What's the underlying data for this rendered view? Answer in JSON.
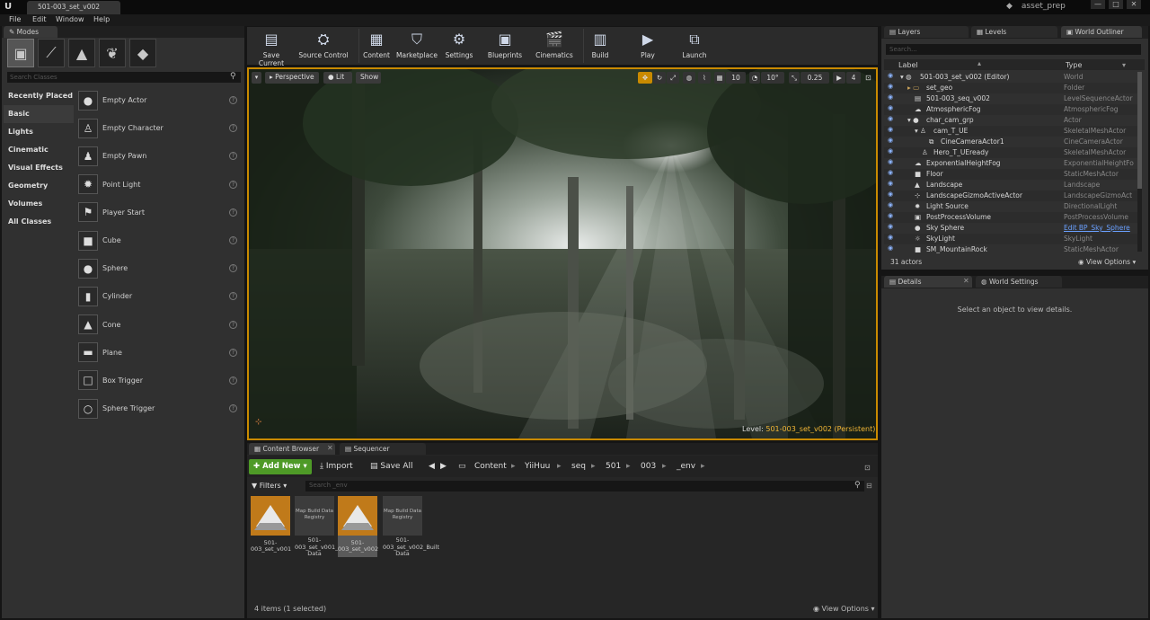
{
  "window": {
    "doc_tab": "501-003_set_v002",
    "project_name": "asset_prep",
    "controls": [
      "—",
      "□",
      "✕"
    ]
  },
  "menu": [
    "File",
    "Edit",
    "Window",
    "Help"
  ],
  "modes": {
    "tab_label": "Modes",
    "search_placeholder": "Search Classes",
    "categories": [
      "Recently Placed",
      "Basic",
      "Lights",
      "Cinematic",
      "Visual Effects",
      "Geometry",
      "Volumes",
      "All Classes"
    ],
    "active_category": "Basic",
    "classes": [
      "Empty Actor",
      "Empty Character",
      "Empty Pawn",
      "Point Light",
      "Player Start",
      "Cube",
      "Sphere",
      "Cylinder",
      "Cone",
      "Plane",
      "Box Trigger",
      "Sphere Trigger"
    ],
    "help_glyph": "?"
  },
  "toolbar": {
    "buttons": [
      "Save Current",
      "Source Control",
      "Content",
      "Marketplace",
      "Settings",
      "Blueprints",
      "Cinematics",
      "Build",
      "Play",
      "Launch"
    ]
  },
  "viewport": {
    "mode_buttons": [
      "Perspective",
      "Lit",
      "Show"
    ],
    "grid_snap": "10",
    "rot_snap": "10°",
    "scale_snap": "0.25",
    "camera_speed": "4",
    "level_label": "Level:",
    "level_value": "501-003_set_v002 (Persistent)"
  },
  "content_browser": {
    "tabs": [
      "Content Browser",
      "Sequencer"
    ],
    "add_new": "Add New",
    "import": "Import",
    "save_all": "Save All",
    "breadcrumb": [
      "Content",
      "YiiHuu",
      "seq",
      "501",
      "003",
      "_env"
    ],
    "filters": "Filters",
    "search_placeholder": "Search _env",
    "assets": [
      {
        "label": "501-003_set_v001",
        "thumb": "level",
        "selected": false
      },
      {
        "label": "501-003_set_v001_Built Data",
        "thumb": "Map Build Data Registry",
        "selected": false
      },
      {
        "label": "501-003_set_v002",
        "thumb": "level",
        "selected": true
      },
      {
        "label": "501-003_set_v002_Built Data",
        "thumb": "Map Build Data Registry",
        "selected": false
      }
    ],
    "status": "4 items (1 selected)",
    "view_options": "View Options"
  },
  "outliner": {
    "tabs": [
      "Layers",
      "Levels",
      "World Outliner"
    ],
    "search_placeholder": "Search...",
    "col_label": "Label",
    "col_type": "Type",
    "rows": [
      {
        "label": "501-003_set_v002 (Editor)",
        "type": "World"
      },
      {
        "label": "set_geo",
        "type": "Folder"
      },
      {
        "label": "501-003_seq_v002",
        "type": "LevelSequenceActor"
      },
      {
        "label": "AtmosphericFog",
        "type": "AtmosphericFog"
      },
      {
        "label": "char_cam_grp",
        "type": "Actor"
      },
      {
        "label": "cam_T_UE",
        "type": "SkeletalMeshActor"
      },
      {
        "label": "CineCameraActor1",
        "type": "CineCameraActor"
      },
      {
        "label": "Hero_T_UEready",
        "type": "SkeletalMeshActor"
      },
      {
        "label": "ExponentialHeightFog",
        "type": "ExponentialHeightFo"
      },
      {
        "label": "Floor",
        "type": "StaticMeshActor"
      },
      {
        "label": "Landscape",
        "type": "Landscape"
      },
      {
        "label": "LandscapeGizmoActiveActor",
        "type": "LandscapeGizmoAct"
      },
      {
        "label": "Light Source",
        "type": "DirectionalLight"
      },
      {
        "label": "PostProcessVolume",
        "type": "PostProcessVolume"
      },
      {
        "label": "Sky Sphere",
        "type": "Edit BP_Sky_Sphere"
      },
      {
        "label": "SkyLight",
        "type": "SkyLight"
      },
      {
        "label": "SM_MountainRock",
        "type": "StaticMeshActor"
      }
    ],
    "actor_count": "31 actors",
    "view_options": "View Options"
  },
  "details": {
    "tabs": [
      "Details",
      "World Settings"
    ],
    "empty_message": "Select an object to view details."
  },
  "colors": {
    "accent_orange": "#c98a00",
    "add_new_green": "#4e9a27",
    "level_text": "#f2b635",
    "link_blue": "#6aa0ff"
  }
}
